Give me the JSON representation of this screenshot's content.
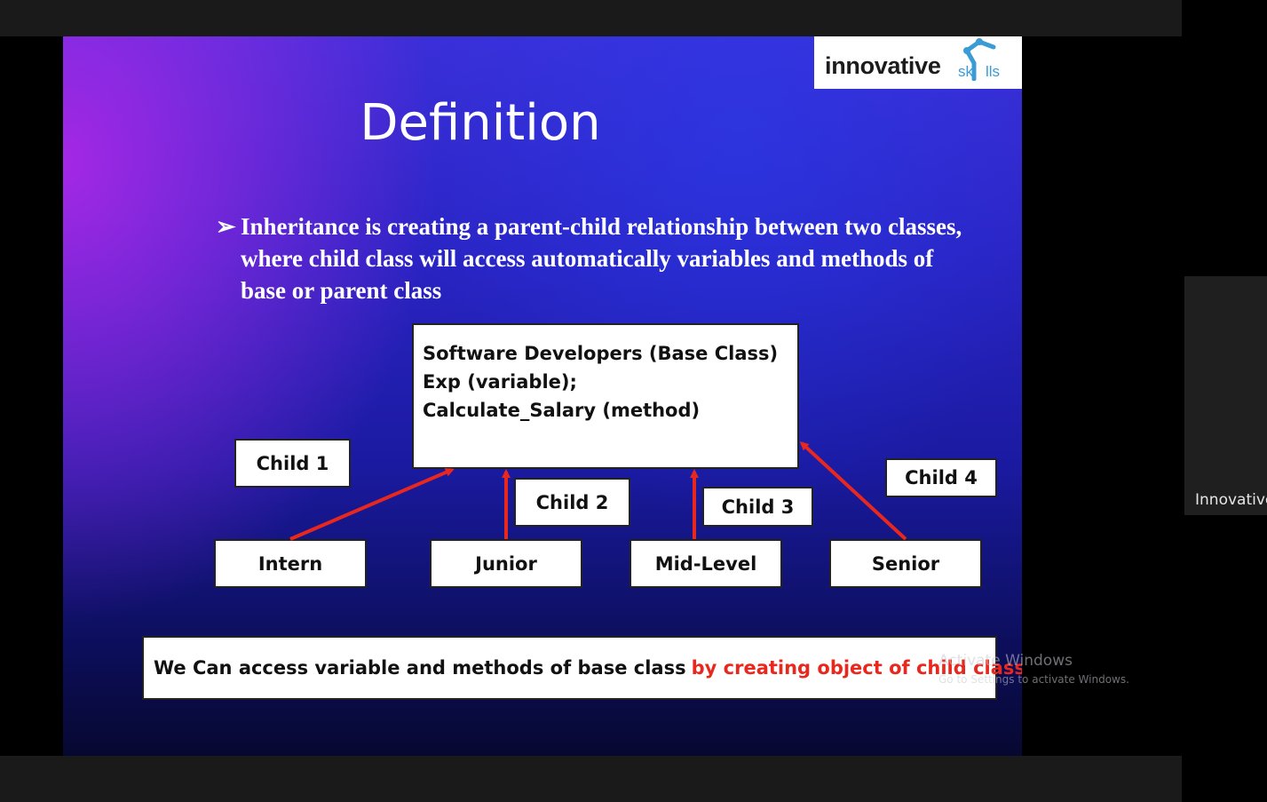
{
  "logo": {
    "brand_main": "innovative",
    "brand_sub": "sk",
    "brand_end": "lls"
  },
  "slide": {
    "title": "Definition",
    "bullet_glyph": "➢",
    "bullet_text": "Inheritance is creating a parent-child relationship between two classes, where child class will access automatically variables and methods of base or parent class"
  },
  "base_class": {
    "line1": "Software Developers (Base Class)",
    "line2": "Exp (variable);",
    "line3": "Calculate_Salary (method)"
  },
  "children": {
    "labels": [
      "Child 1",
      "Child 2",
      "Child 3",
      "Child 4"
    ],
    "names": [
      "Intern",
      "Junior",
      "Mid-Level",
      "Senior"
    ]
  },
  "note": {
    "plain": "We Can access variable and methods of base class",
    "highlight": "by creating object of child class"
  },
  "watermark": {
    "line1": "Activate Windows",
    "line2": "Go to Settings to activate Windows."
  },
  "participant": {
    "name": "Innovative"
  },
  "colors": {
    "arrow": "#e8281e",
    "highlight": "#e8281e",
    "logo_accent": "#3a9bd5"
  },
  "icons": {
    "logo_mark": "robot-arm-icon",
    "bullet": "arrow-bullet-icon"
  }
}
